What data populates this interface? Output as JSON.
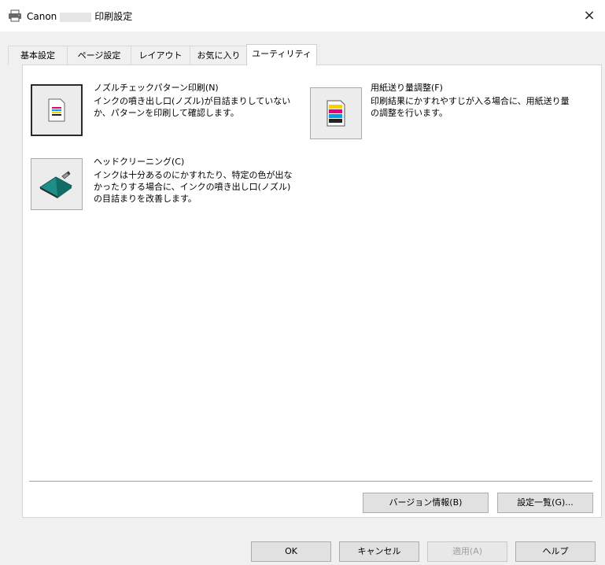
{
  "window": {
    "title_prefix": "Canon",
    "title_suffix": "印刷設定",
    "close_label": "×"
  },
  "tabs": [
    {
      "label": "基本設定"
    },
    {
      "label": "ページ設定"
    },
    {
      "label": "レイアウト"
    },
    {
      "label": "お気に入り"
    },
    {
      "label": "ユーティリティ"
    }
  ],
  "utilities": {
    "nozzle_check": {
      "title": "ノズルチェックパターン印刷(N)",
      "desc": "インクの噴き出し口(ノズル)が目詰まりしていないか、パターンを印刷して確認します。"
    },
    "paper_feed": {
      "title": "用紙送り量調整(F)",
      "desc": "印刷結果にかすれやすじが入る場合に、用紙送り量の調整を行います。"
    },
    "head_cleaning": {
      "title": "ヘッドクリーニング(C)",
      "desc": "インクは十分あるのにかすれたり、特定の色が出なかったりする場合に、インクの噴き出し口(ノズル)の目詰まりを改善します。"
    }
  },
  "panel_buttons": {
    "version_info": "バージョン情報(B)",
    "settings_list": "設定一覧(G)..."
  },
  "dialog_buttons": {
    "ok": "OK",
    "cancel": "キャンセル",
    "apply": "適用(A)",
    "help": "ヘルプ"
  }
}
